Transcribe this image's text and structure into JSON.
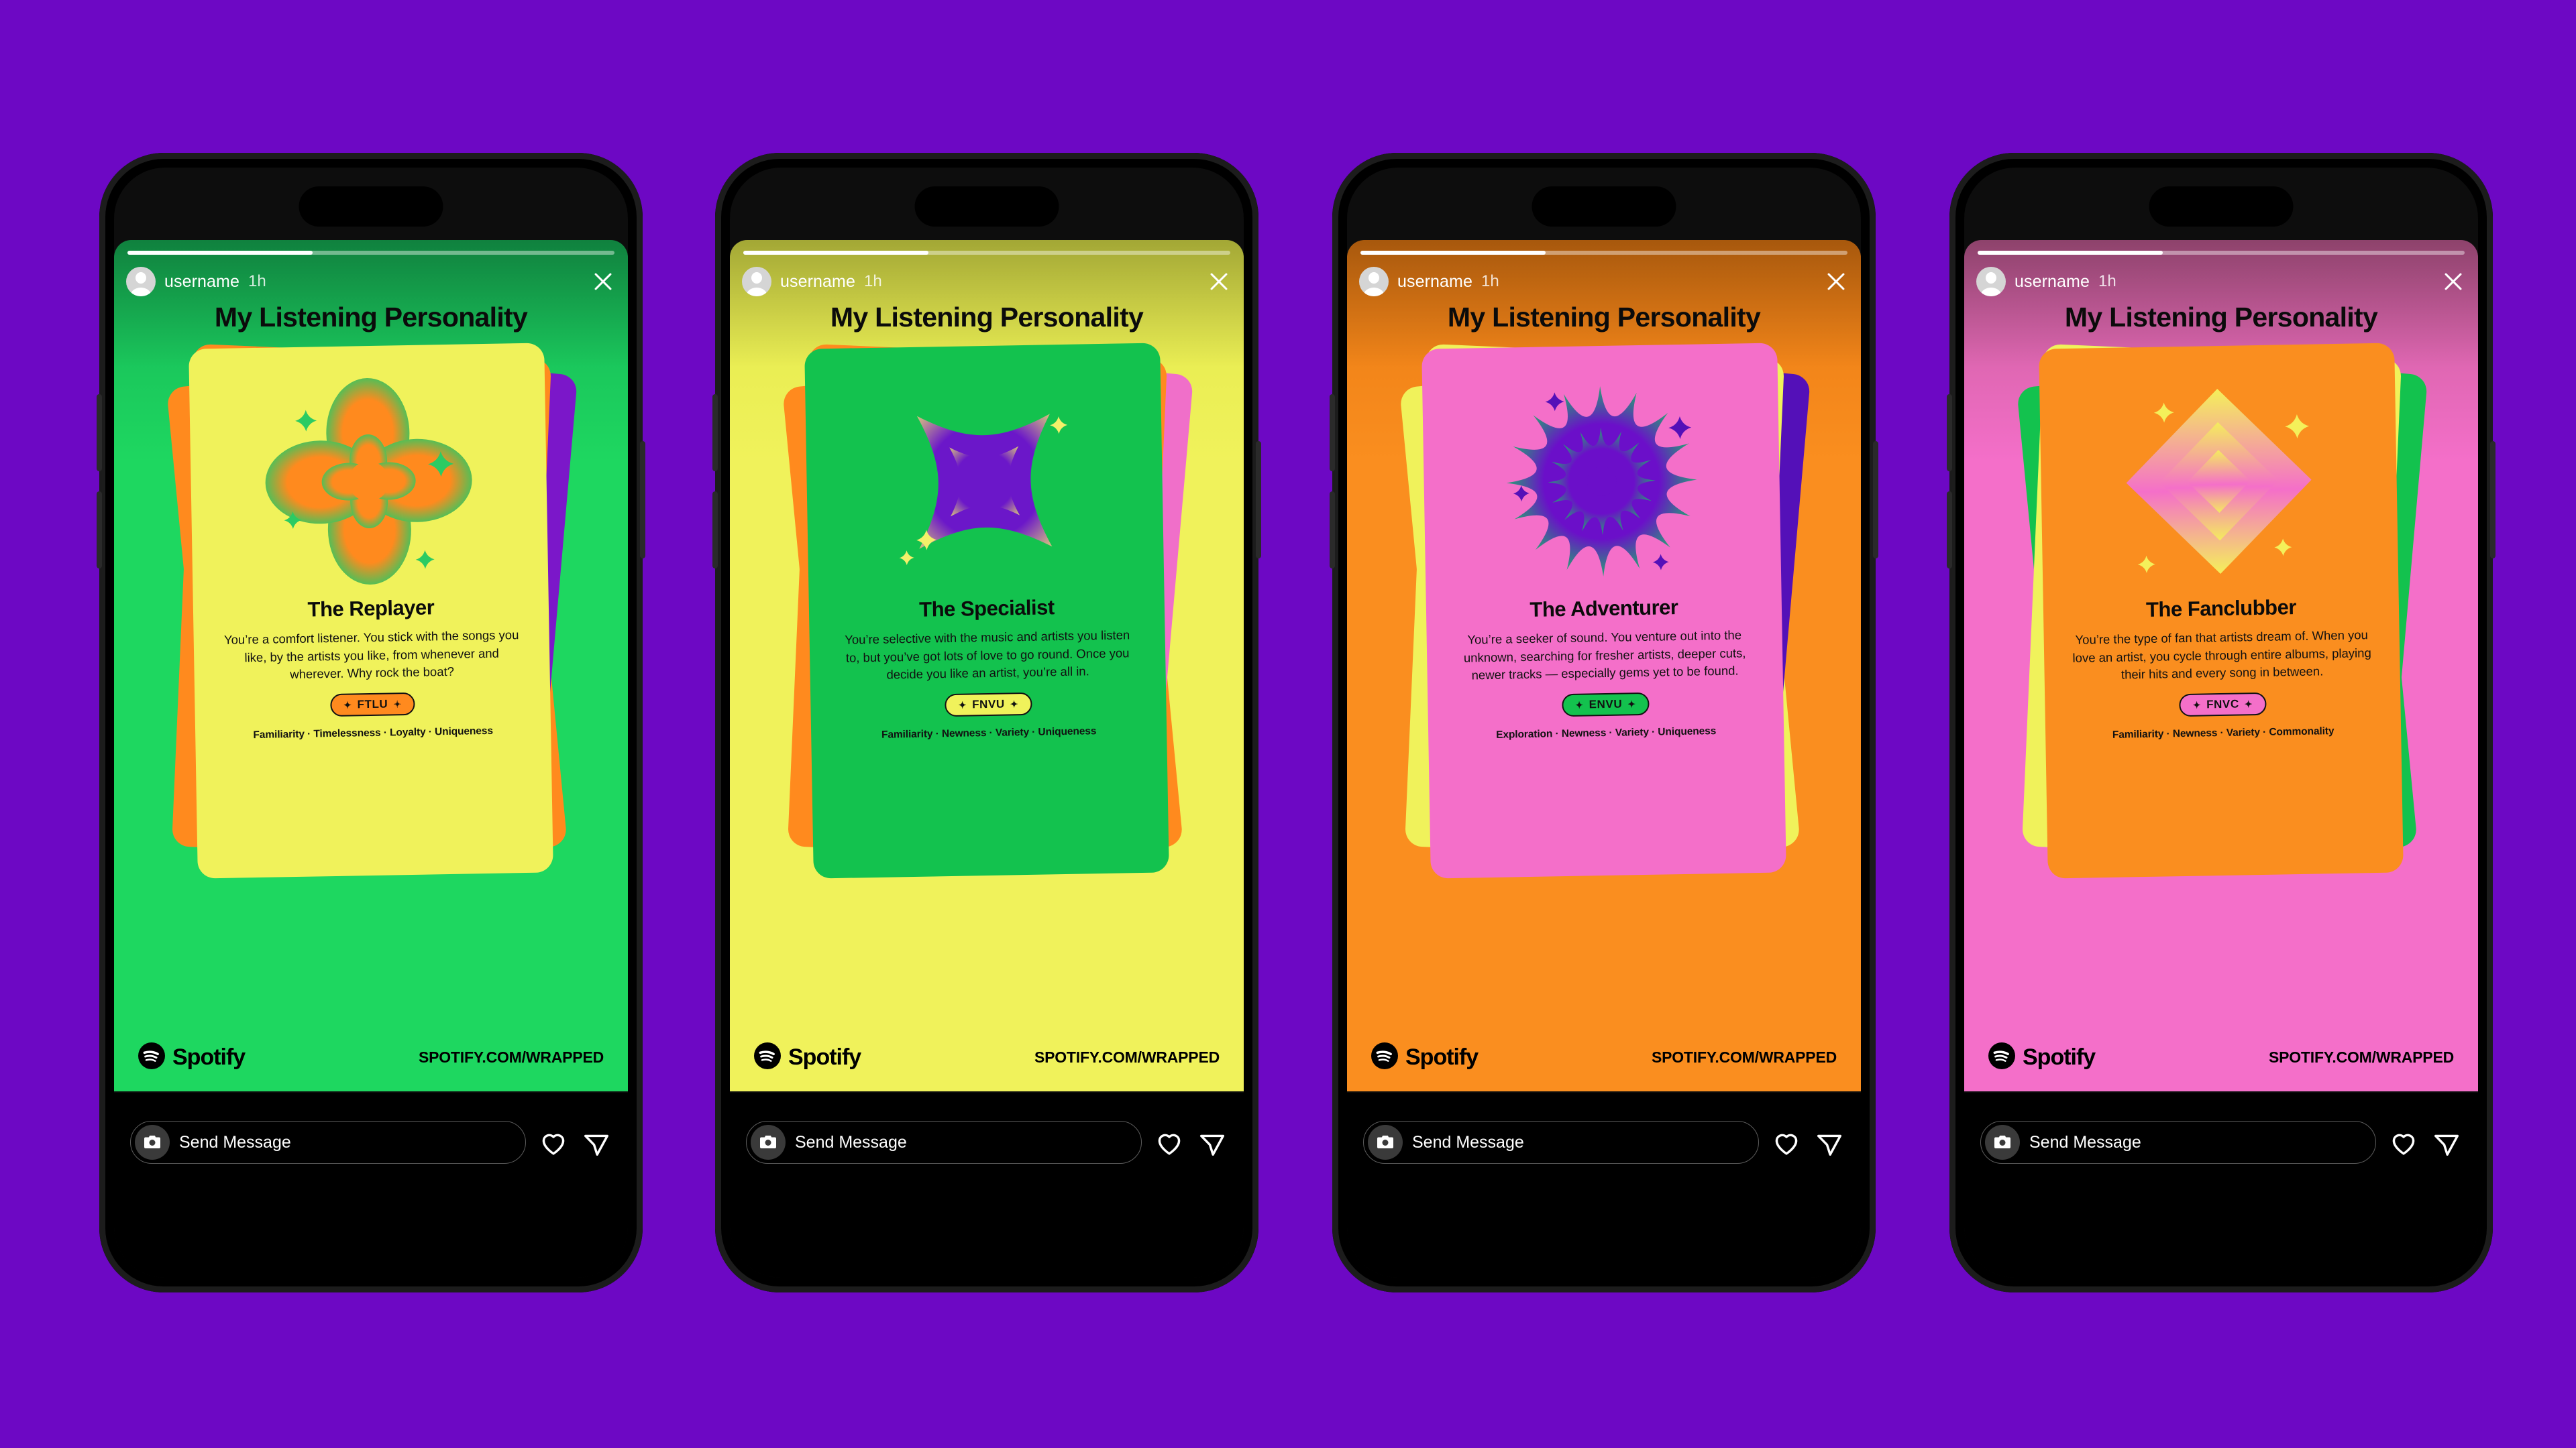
{
  "page": {
    "background_color": "#6D08C4",
    "app": "Instagram Story",
    "shared_from": "Spotify Wrapped"
  },
  "story_ui": {
    "username": "username",
    "timestamp": "1h",
    "close_label": "×",
    "progress_percent": 38,
    "title": "My Listening Personality",
    "brand_name": "Spotify",
    "wrapped_url": "SPOTIFY.COM/WRAPPED",
    "reply_placeholder": "Send Message",
    "icons": {
      "avatar": "avatar-icon",
      "close": "close-icon",
      "camera": "camera-icon",
      "like": "heart-icon",
      "share": "paper-plane-icon",
      "spotify": "spotify-logo-icon"
    }
  },
  "phones": [
    {
      "id": "phone-1",
      "bg_top": "#16b356",
      "bg_bottom": "#1ed760",
      "card_bg": "#F0F25B",
      "stack_colors": [
        "#FF8A1E",
        "#7B17C9",
        "#FF8A1E"
      ],
      "chip_bg": "#FF8A1E",
      "art": {
        "name": "clover-flower-icon",
        "type": "clover",
        "color_outer": "#2BCB63",
        "color_inner": "#FF8A1E",
        "sparkle_color": "#2BCB63"
      },
      "card": {
        "name": "The Replayer",
        "description": "You’re a comfort listener. You stick with the songs you like, by the artists you like, from whenever and wherever. Why rock the boat?",
        "code": "FTLU",
        "traits": "Familiarity · Timelessness · Loyalty · Uniqueness"
      }
    },
    {
      "id": "phone-2",
      "bg_top": "#e2e84a",
      "bg_bottom": "#F0F25B",
      "card_bg": "#13C24E",
      "stack_colors": [
        "#FF8A1E",
        "#F06FC9",
        "#FF8A1E"
      ],
      "chip_bg": "#F0F25B",
      "art": {
        "name": "four-point-star-icon",
        "type": "star4",
        "color_outer": "#F4F06A",
        "color_inner": "#6B17C9",
        "sparkle_color": "#F4F06A"
      },
      "card": {
        "name": "The Specialist",
        "description": "You’re selective with the music and artists you listen to, but you’ve got lots of love to go round. Once you decide you like an artist, you’re all in.",
        "code": "FNVU",
        "traits": "Familiarity · Newness · Variety · Uniqueness"
      }
    },
    {
      "id": "phone-3",
      "bg_top": "#e87a12",
      "bg_bottom": "#FA8E1F",
      "card_bg": "#F46FC9",
      "stack_colors": [
        "#F0F25B",
        "#5410B8",
        "#F0F25B"
      ],
      "chip_bg": "#13C24E",
      "art": {
        "name": "sunburst-icon",
        "type": "burst",
        "color_outer": "#14C95C",
        "color_inner": "#6B0FC9",
        "sparkle_color": "#5410B8"
      },
      "card": {
        "name": "The Adventurer",
        "description": "You’re a seeker of sound. You venture out into the unknown, searching for fresher artists, deeper cuts, newer tracks — especially gems yet to be found.",
        "code": "ENVU",
        "traits": "Exploration · Newness · Variety · Uniqueness"
      }
    },
    {
      "id": "phone-4",
      "bg_top": "#c45c95",
      "bg_bottom": "#F46FC9",
      "card_bg": "#FA8E1F",
      "stack_colors": [
        "#F0F25B",
        "#13C24E",
        "#13C24E"
      ],
      "chip_bg": "#F46FC9",
      "art": {
        "name": "nested-diamonds-icon",
        "type": "diamond",
        "color_outer": "#F4F05A",
        "color_inner": "#F46FC9",
        "sparkle_color": "#F4F05A"
      },
      "card": {
        "name": "The Fanclubber",
        "description": "You’re the type of fan that artists dream of. When you love an artist, you cycle through entire albums, playing their hits and every song in between.",
        "code": "FNVC",
        "traits": "Familiarity · Newness · Variety · Commonality"
      }
    }
  ]
}
